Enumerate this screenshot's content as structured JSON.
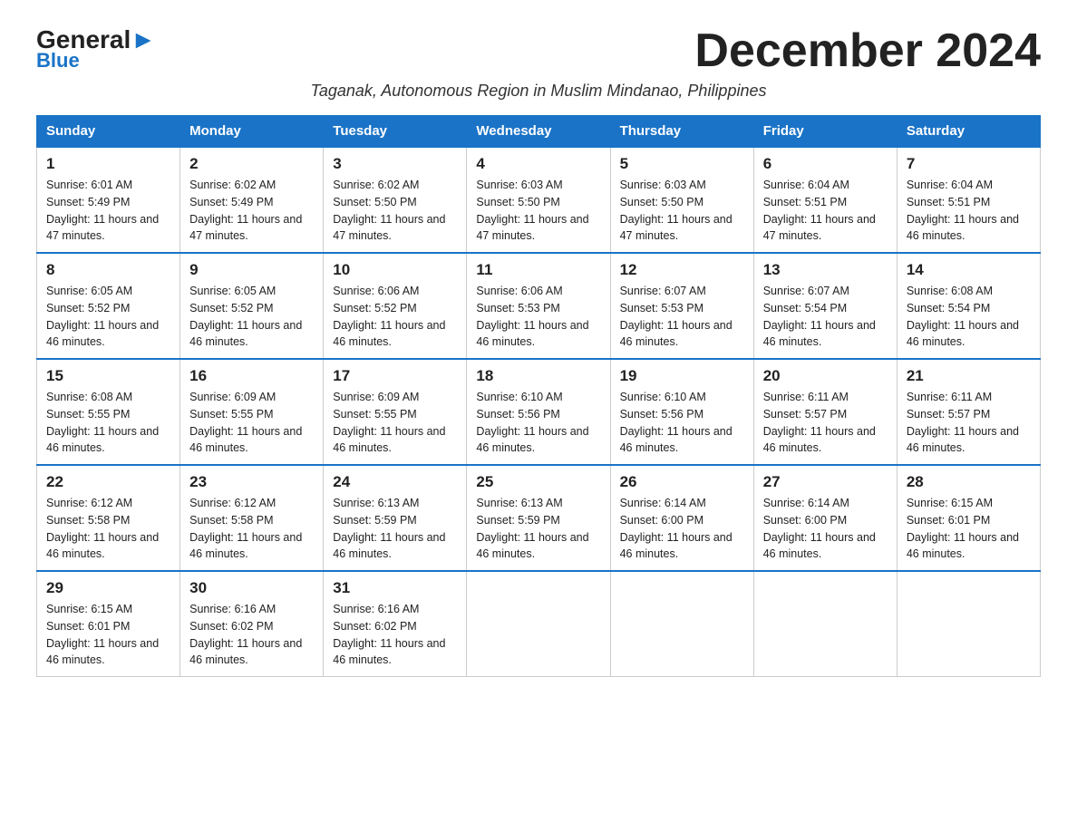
{
  "logo": {
    "general": "General",
    "arrow": "▶",
    "blue": "Blue"
  },
  "title": "December 2024",
  "subtitle": "Taganak, Autonomous Region in Muslim Mindanao, Philippines",
  "headers": [
    "Sunday",
    "Monday",
    "Tuesday",
    "Wednesday",
    "Thursday",
    "Friday",
    "Saturday"
  ],
  "weeks": [
    [
      {
        "day": "1",
        "sunrise": "6:01 AM",
        "sunset": "5:49 PM",
        "daylight": "11 hours and 47 minutes."
      },
      {
        "day": "2",
        "sunrise": "6:02 AM",
        "sunset": "5:49 PM",
        "daylight": "11 hours and 47 minutes."
      },
      {
        "day": "3",
        "sunrise": "6:02 AM",
        "sunset": "5:50 PM",
        "daylight": "11 hours and 47 minutes."
      },
      {
        "day": "4",
        "sunrise": "6:03 AM",
        "sunset": "5:50 PM",
        "daylight": "11 hours and 47 minutes."
      },
      {
        "day": "5",
        "sunrise": "6:03 AM",
        "sunset": "5:50 PM",
        "daylight": "11 hours and 47 minutes."
      },
      {
        "day": "6",
        "sunrise": "6:04 AM",
        "sunset": "5:51 PM",
        "daylight": "11 hours and 47 minutes."
      },
      {
        "day": "7",
        "sunrise": "6:04 AM",
        "sunset": "5:51 PM",
        "daylight": "11 hours and 46 minutes."
      }
    ],
    [
      {
        "day": "8",
        "sunrise": "6:05 AM",
        "sunset": "5:52 PM",
        "daylight": "11 hours and 46 minutes."
      },
      {
        "day": "9",
        "sunrise": "6:05 AM",
        "sunset": "5:52 PM",
        "daylight": "11 hours and 46 minutes."
      },
      {
        "day": "10",
        "sunrise": "6:06 AM",
        "sunset": "5:52 PM",
        "daylight": "11 hours and 46 minutes."
      },
      {
        "day": "11",
        "sunrise": "6:06 AM",
        "sunset": "5:53 PM",
        "daylight": "11 hours and 46 minutes."
      },
      {
        "day": "12",
        "sunrise": "6:07 AM",
        "sunset": "5:53 PM",
        "daylight": "11 hours and 46 minutes."
      },
      {
        "day": "13",
        "sunrise": "6:07 AM",
        "sunset": "5:54 PM",
        "daylight": "11 hours and 46 minutes."
      },
      {
        "day": "14",
        "sunrise": "6:08 AM",
        "sunset": "5:54 PM",
        "daylight": "11 hours and 46 minutes."
      }
    ],
    [
      {
        "day": "15",
        "sunrise": "6:08 AM",
        "sunset": "5:55 PM",
        "daylight": "11 hours and 46 minutes."
      },
      {
        "day": "16",
        "sunrise": "6:09 AM",
        "sunset": "5:55 PM",
        "daylight": "11 hours and 46 minutes."
      },
      {
        "day": "17",
        "sunrise": "6:09 AM",
        "sunset": "5:55 PM",
        "daylight": "11 hours and 46 minutes."
      },
      {
        "day": "18",
        "sunrise": "6:10 AM",
        "sunset": "5:56 PM",
        "daylight": "11 hours and 46 minutes."
      },
      {
        "day": "19",
        "sunrise": "6:10 AM",
        "sunset": "5:56 PM",
        "daylight": "11 hours and 46 minutes."
      },
      {
        "day": "20",
        "sunrise": "6:11 AM",
        "sunset": "5:57 PM",
        "daylight": "11 hours and 46 minutes."
      },
      {
        "day": "21",
        "sunrise": "6:11 AM",
        "sunset": "5:57 PM",
        "daylight": "11 hours and 46 minutes."
      }
    ],
    [
      {
        "day": "22",
        "sunrise": "6:12 AM",
        "sunset": "5:58 PM",
        "daylight": "11 hours and 46 minutes."
      },
      {
        "day": "23",
        "sunrise": "6:12 AM",
        "sunset": "5:58 PM",
        "daylight": "11 hours and 46 minutes."
      },
      {
        "day": "24",
        "sunrise": "6:13 AM",
        "sunset": "5:59 PM",
        "daylight": "11 hours and 46 minutes."
      },
      {
        "day": "25",
        "sunrise": "6:13 AM",
        "sunset": "5:59 PM",
        "daylight": "11 hours and 46 minutes."
      },
      {
        "day": "26",
        "sunrise": "6:14 AM",
        "sunset": "6:00 PM",
        "daylight": "11 hours and 46 minutes."
      },
      {
        "day": "27",
        "sunrise": "6:14 AM",
        "sunset": "6:00 PM",
        "daylight": "11 hours and 46 minutes."
      },
      {
        "day": "28",
        "sunrise": "6:15 AM",
        "sunset": "6:01 PM",
        "daylight": "11 hours and 46 minutes."
      }
    ],
    [
      {
        "day": "29",
        "sunrise": "6:15 AM",
        "sunset": "6:01 PM",
        "daylight": "11 hours and 46 minutes."
      },
      {
        "day": "30",
        "sunrise": "6:16 AM",
        "sunset": "6:02 PM",
        "daylight": "11 hours and 46 minutes."
      },
      {
        "day": "31",
        "sunrise": "6:16 AM",
        "sunset": "6:02 PM",
        "daylight": "11 hours and 46 minutes."
      },
      {
        "day": "",
        "sunrise": "",
        "sunset": "",
        "daylight": ""
      },
      {
        "day": "",
        "sunrise": "",
        "sunset": "",
        "daylight": ""
      },
      {
        "day": "",
        "sunrise": "",
        "sunset": "",
        "daylight": ""
      },
      {
        "day": "",
        "sunrise": "",
        "sunset": "",
        "daylight": ""
      }
    ]
  ]
}
